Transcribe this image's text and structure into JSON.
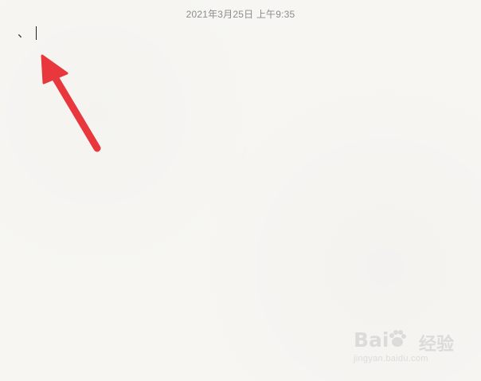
{
  "note": {
    "timestamp": "2021年3月25日 上午9:35",
    "body_text": "、"
  },
  "annotation": {
    "arrow_color": "#e8383d",
    "arrow_icon": "red-arrow-icon"
  },
  "watermark": {
    "brand": "Bai",
    "brand_icon": "baidu-paw-icon",
    "jingyan": "经验",
    "url": "jingyan.baidu.com"
  },
  "colors": {
    "background": "#f7f6f3",
    "timestamp_text": "#8c8c8c",
    "caret": "#222222"
  }
}
